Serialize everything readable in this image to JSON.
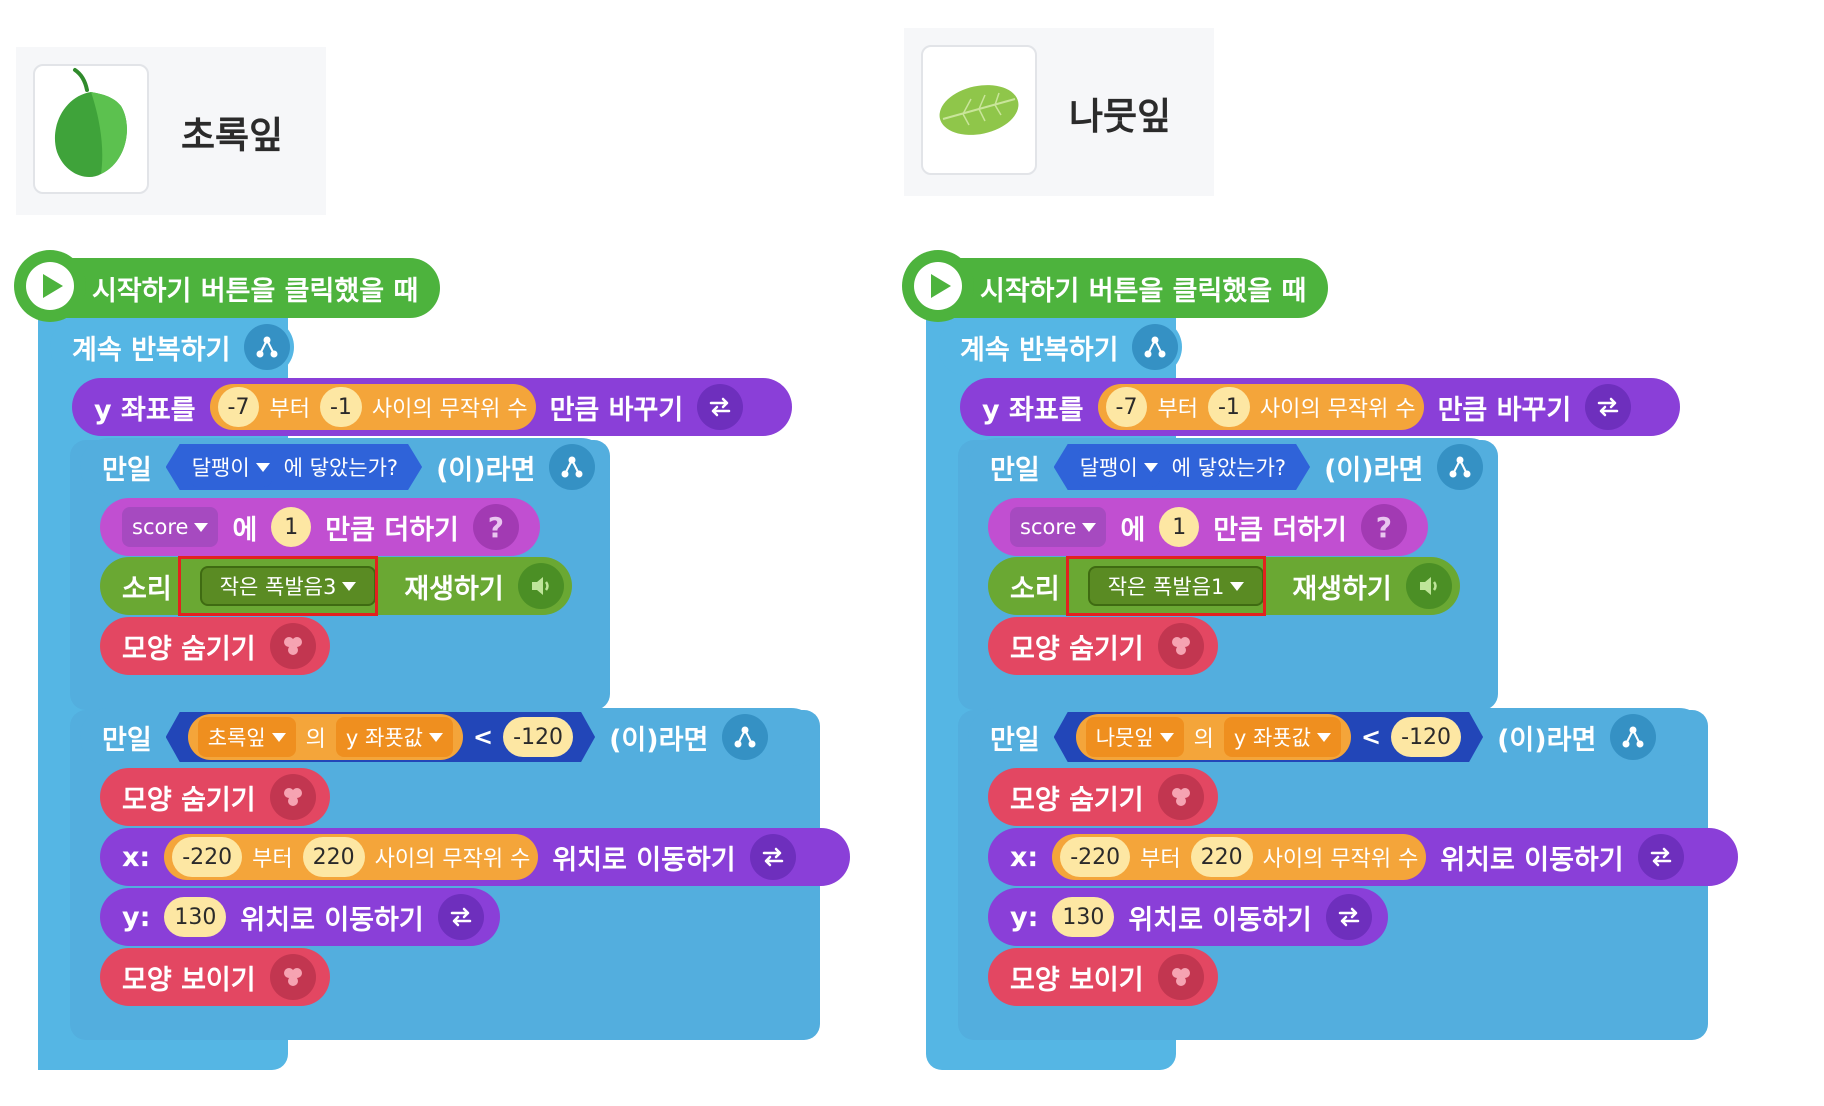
{
  "left": {
    "sprite_name": "초록잎",
    "hat_label": "시작하기 버튼을 클릭했을 때",
    "forever_label": "계속 반복하기",
    "change_y": {
      "prefix": "y 좌표를",
      "from": "-7",
      "from_word": "부터",
      "to": "-1",
      "rand_label": "사이의 무작위 수",
      "suffix": "만큼 바꾸기"
    },
    "if1": {
      "label": "만일",
      "target": "달팽이",
      "touch_label": "에 닿았는가?",
      "then_label": "(이)라면"
    },
    "add_var": {
      "var": "score",
      "to_word": "에",
      "value": "1",
      "suffix": "만큼 더하기",
      "help": "?"
    },
    "sound": {
      "label": "소리",
      "name": "작은 폭발음3",
      "suffix": "재생하기"
    },
    "hide1": "모양 숨기기",
    "if2": {
      "label": "만일",
      "object": "초록잎",
      "of_word": "의",
      "prop": "y 좌푯값",
      "op": "<",
      "value": "-120",
      "then_label": "(이)라면"
    },
    "hide2": "모양 숨기기",
    "move_x": {
      "prefix": "x:",
      "from": "-220",
      "from_word": "부터",
      "to": "220",
      "rand_label": "사이의 무작위 수",
      "suffix": "위치로 이동하기"
    },
    "move_y": {
      "prefix": "y:",
      "value": "130",
      "suffix": "위치로 이동하기"
    },
    "show": "모양 보이기"
  },
  "right": {
    "sprite_name": "나뭇잎",
    "hat_label": "시작하기 버튼을 클릭했을 때",
    "forever_label": "계속 반복하기",
    "change_y": {
      "prefix": "y 좌표를",
      "from": "-7",
      "from_word": "부터",
      "to": "-1",
      "rand_label": "사이의 무작위 수",
      "suffix": "만큼 바꾸기"
    },
    "if1": {
      "label": "만일",
      "target": "달팽이",
      "touch_label": "에 닿았는가?",
      "then_label": "(이)라면"
    },
    "add_var": {
      "var": "score",
      "to_word": "에",
      "value": "1",
      "suffix": "만큼 더하기",
      "help": "?"
    },
    "sound": {
      "label": "소리",
      "name": "작은 폭발음1",
      "suffix": "재생하기"
    },
    "hide1": "모양 숨기기",
    "if2": {
      "label": "만일",
      "object": "나뭇잎",
      "of_word": "의",
      "prop": "y 좌푯값",
      "op": "<",
      "value": "-120",
      "then_label": "(이)라면"
    },
    "hide2": "모양 숨기기",
    "move_x": {
      "prefix": "x:",
      "from": "-220",
      "from_word": "부터",
      "to": "220",
      "rand_label": "사이의 무작위 수",
      "suffix": "위치로 이동하기"
    },
    "move_y": {
      "prefix": "y:",
      "value": "130",
      "suffix": "위치로 이동하기"
    },
    "show": "모양 보이기"
  },
  "colors": {
    "highlight": "#e3211f",
    "event": "#4db33d",
    "flow": "#55b6e4",
    "motion": "#8a3fd8",
    "looks": "#e34762",
    "sound": "#6aa833",
    "variable": "#c14fd1"
  }
}
